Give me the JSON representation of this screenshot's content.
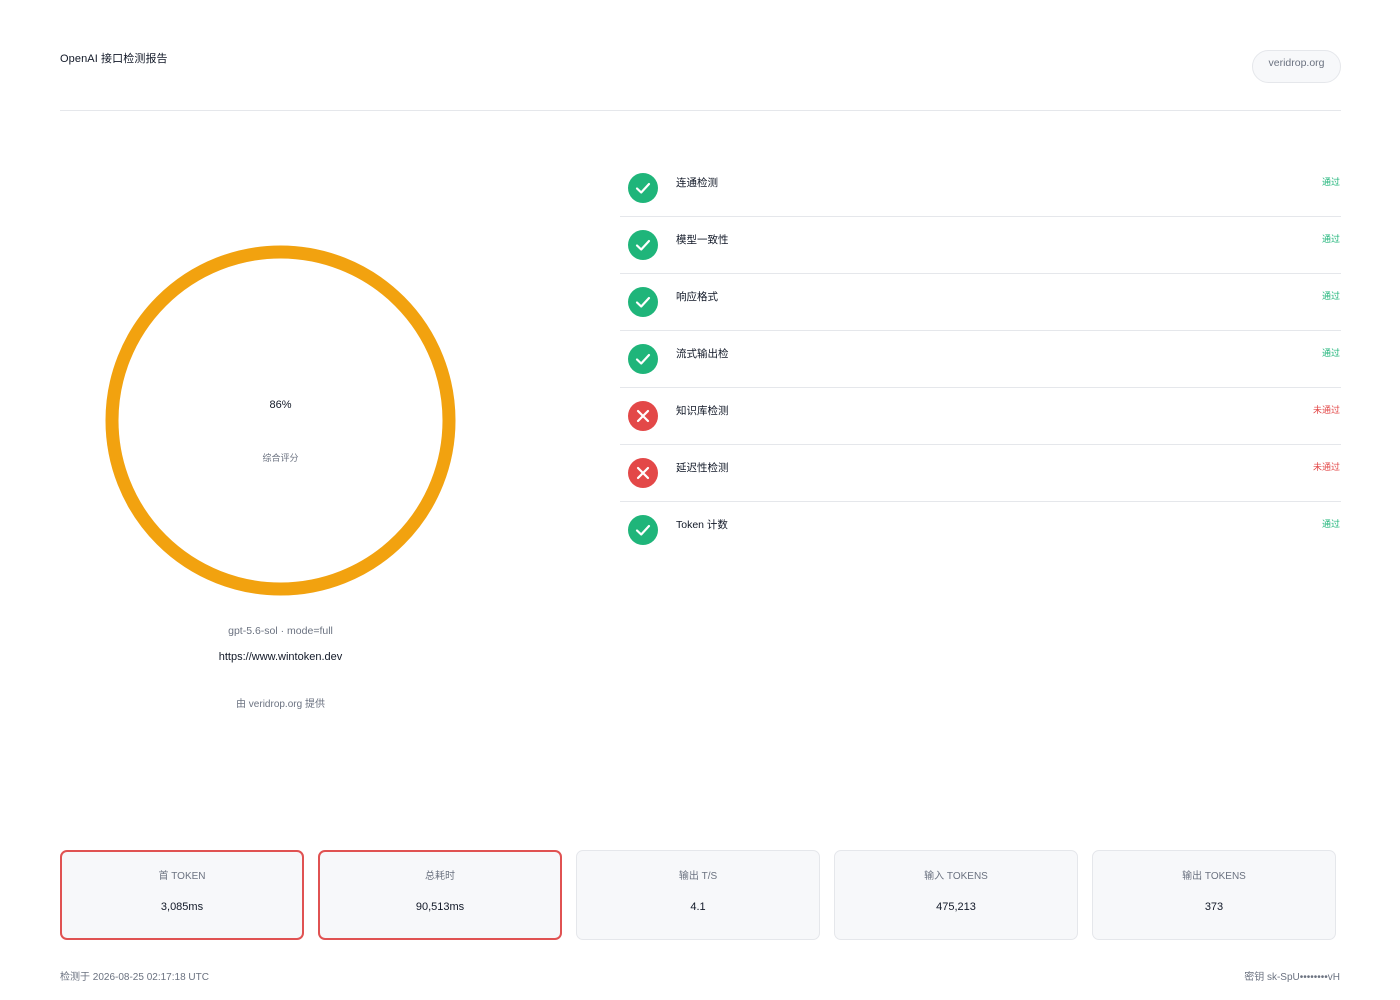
{
  "header": {
    "title": "OpenAI 接口检测报告",
    "domain_badge": "veridrop.org"
  },
  "score": {
    "percent": "86%",
    "percent_value": 86,
    "label": "综合评分",
    "ring_color": "#f2a20f",
    "model_line": "gpt-5.6-sol · mode=full",
    "endpoint_url": "https://www.wintoken.dev",
    "provided_by": "由 veridrop.org 提供"
  },
  "checks": [
    {
      "name": "连通检测",
      "result": "通过",
      "status": "ok",
      "icon": "check-icon"
    },
    {
      "name": "模型一致性",
      "result": "通过",
      "status": "ok",
      "icon": "check-icon"
    },
    {
      "name": "响应格式",
      "result": "通过",
      "status": "ok",
      "icon": "check-icon"
    },
    {
      "name": "流式输出检",
      "result": "通过",
      "status": "ok",
      "icon": "check-icon"
    },
    {
      "name": "知识库检测",
      "result": "未通过",
      "status": "fail",
      "icon": "close-icon"
    },
    {
      "name": "延迟性检测",
      "result": "未通过",
      "status": "fail",
      "icon": "close-icon"
    },
    {
      "name": "Token 计数",
      "result": "通过",
      "status": "ok",
      "icon": "check-icon"
    }
  ],
  "metrics": [
    {
      "label": "首 TOKEN",
      "value": "3,085ms",
      "alert": true
    },
    {
      "label": "总耗时",
      "value": "90,513ms",
      "alert": true
    },
    {
      "label": "输出 T/S",
      "value": "4.1",
      "alert": false
    },
    {
      "label": "输入 TOKENS",
      "value": "475,213",
      "alert": false
    },
    {
      "label": "输出 TOKENS",
      "value": "373",
      "alert": false
    }
  ],
  "footer": {
    "timestamp": "检测于 2026-08-25 02:17:18 UTC",
    "key": "密钥 sk-SpU••••••••vH"
  },
  "colors": {
    "ok": "#1fb57a",
    "fail": "#e34848",
    "alert_border": "#e05252"
  }
}
